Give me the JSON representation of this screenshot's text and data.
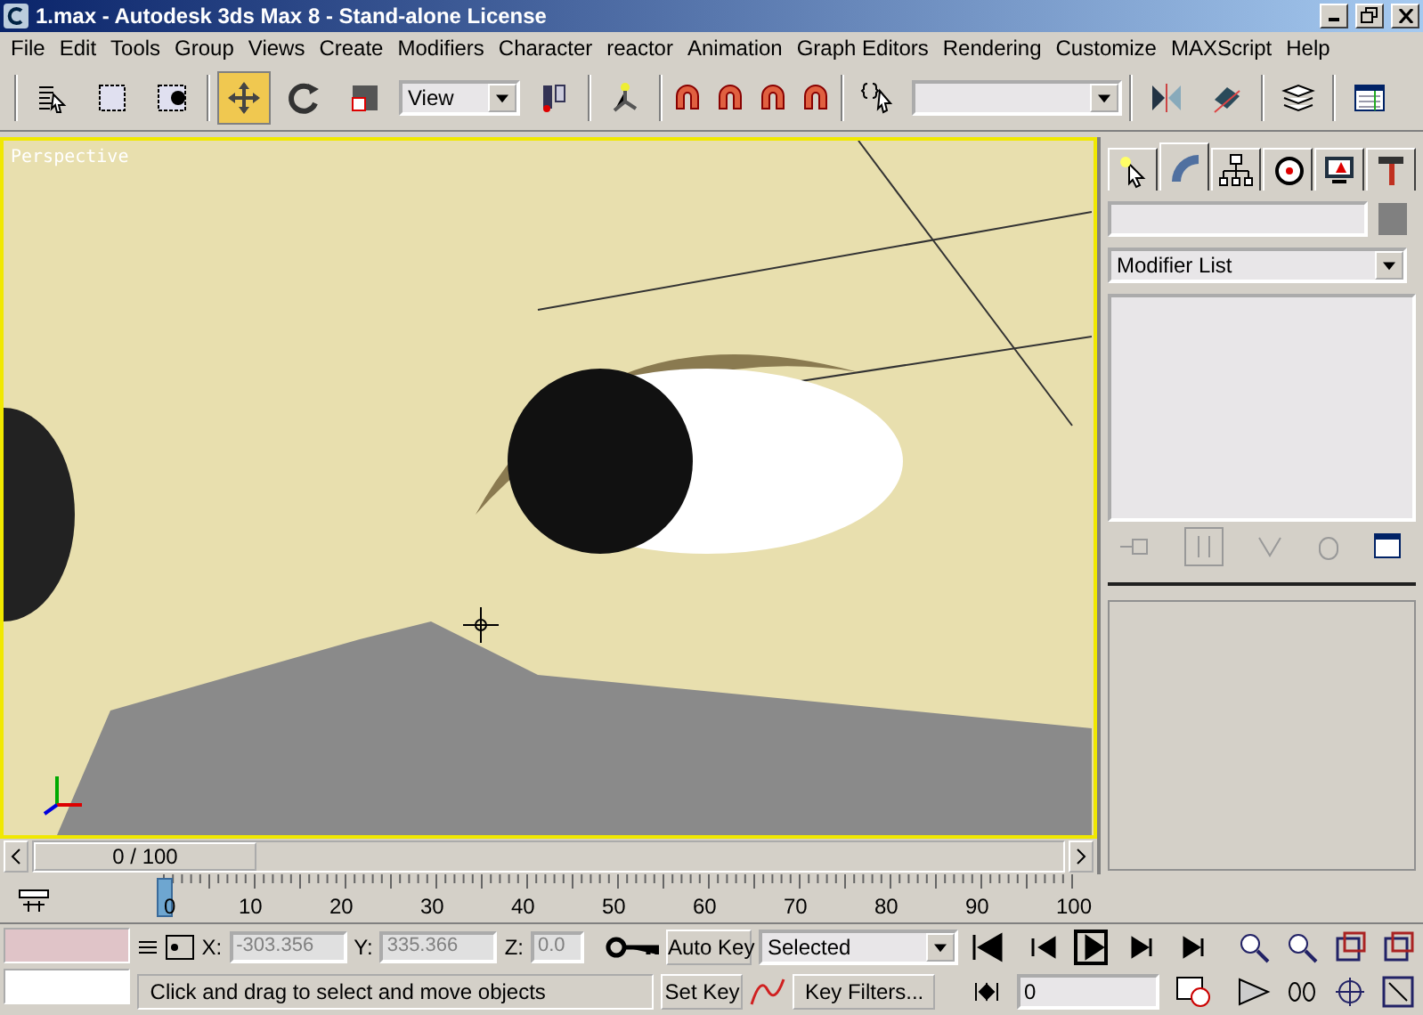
{
  "window": {
    "title": "1.max - Autodesk 3ds Max 8  - Stand-alone License"
  },
  "menu": [
    "File",
    "Edit",
    "Tools",
    "Group",
    "Views",
    "Create",
    "Modifiers",
    "Character",
    "reactor",
    "Animation",
    "Graph Editors",
    "Rendering",
    "Customize",
    "MAXScript",
    "Help"
  ],
  "toolbar": {
    "tools": [
      {
        "selected": false
      },
      {
        "selected": false
      },
      {
        "selected": false
      },
      {
        "selected": true
      },
      {
        "selected": false
      },
      {
        "selected": false
      }
    ],
    "reference_coord": "View"
  },
  "viewport": {
    "label": "Perspective"
  },
  "command_panel": {
    "tabs": [
      {
        "selected": false
      },
      {
        "selected": true
      },
      {
        "selected": false
      },
      {
        "selected": false
      },
      {
        "selected": false
      },
      {
        "selected": false
      }
    ],
    "modifier_list": "Modifier List"
  },
  "time_slider": {
    "label": "0 / 100",
    "level": 0
  },
  "track_bar": {
    "ticks": [
      "0",
      "10",
      "20",
      "30",
      "40",
      "50",
      "60",
      "70",
      "80",
      "90",
      "100"
    ]
  },
  "coordinates": [
    {
      "label": "X:",
      "value": "-303.356"
    },
    {
      "label": "Y:",
      "value": "335.366"
    },
    {
      "label": "Z:",
      "value": "0.0"
    }
  ],
  "prompt": "Click and drag to select and move objects",
  "animation": {
    "auto_key": "Auto Key",
    "key_mode": "Selected",
    "set_key": "Set Key",
    "key_filters": "Key Filters...",
    "frame": "0"
  }
}
